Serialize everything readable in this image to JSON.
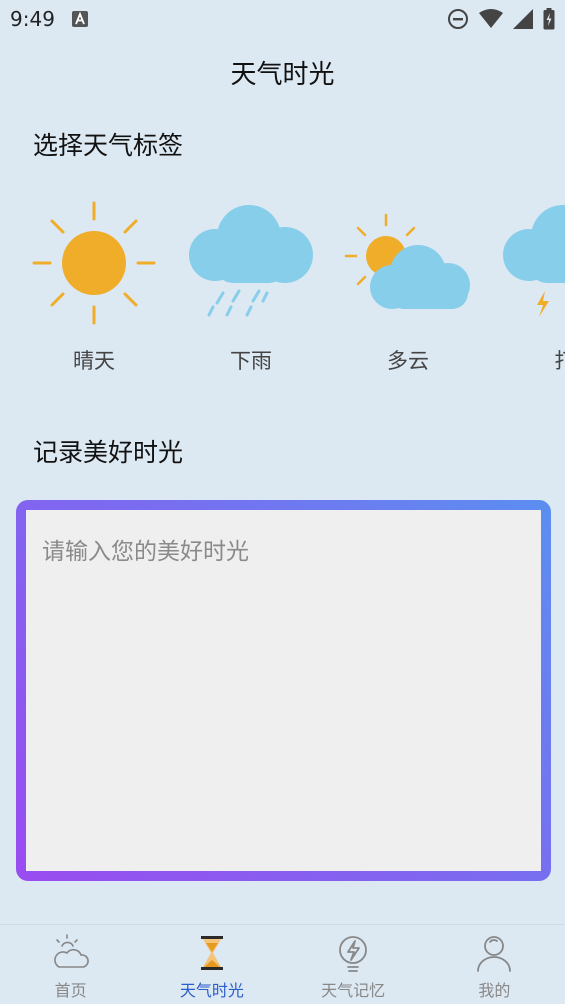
{
  "status_bar": {
    "time": "9:49"
  },
  "header": {
    "title": "天气时光"
  },
  "weather_section": {
    "title": "选择天气标签",
    "tags": [
      {
        "label": "晴天",
        "icon": "sun-icon"
      },
      {
        "label": "下雨",
        "icon": "rain-cloud-icon"
      },
      {
        "label": "多云",
        "icon": "partly-cloudy-icon"
      },
      {
        "label": "打",
        "icon": "thunder-cloud-icon"
      }
    ]
  },
  "memo_section": {
    "title": "记录美好时光",
    "placeholder": "请输入您的美好时光",
    "value": ""
  },
  "bottom_nav": {
    "items": [
      {
        "label": "首页",
        "icon": "cloud-sun-icon"
      },
      {
        "label": "天气时光",
        "icon": "hourglass-icon",
        "active": true
      },
      {
        "label": "天气记忆",
        "icon": "lightbulb-icon"
      },
      {
        "label": "我的",
        "icon": "person-icon"
      }
    ]
  },
  "colors": {
    "background": "#dce8f2",
    "sun": "#f0ad2a",
    "cloud": "#87ceeb",
    "active_tab": "#2b5ec9",
    "gradient_start": "#5b8ff0",
    "gradient_end": "#9a4cf0"
  }
}
